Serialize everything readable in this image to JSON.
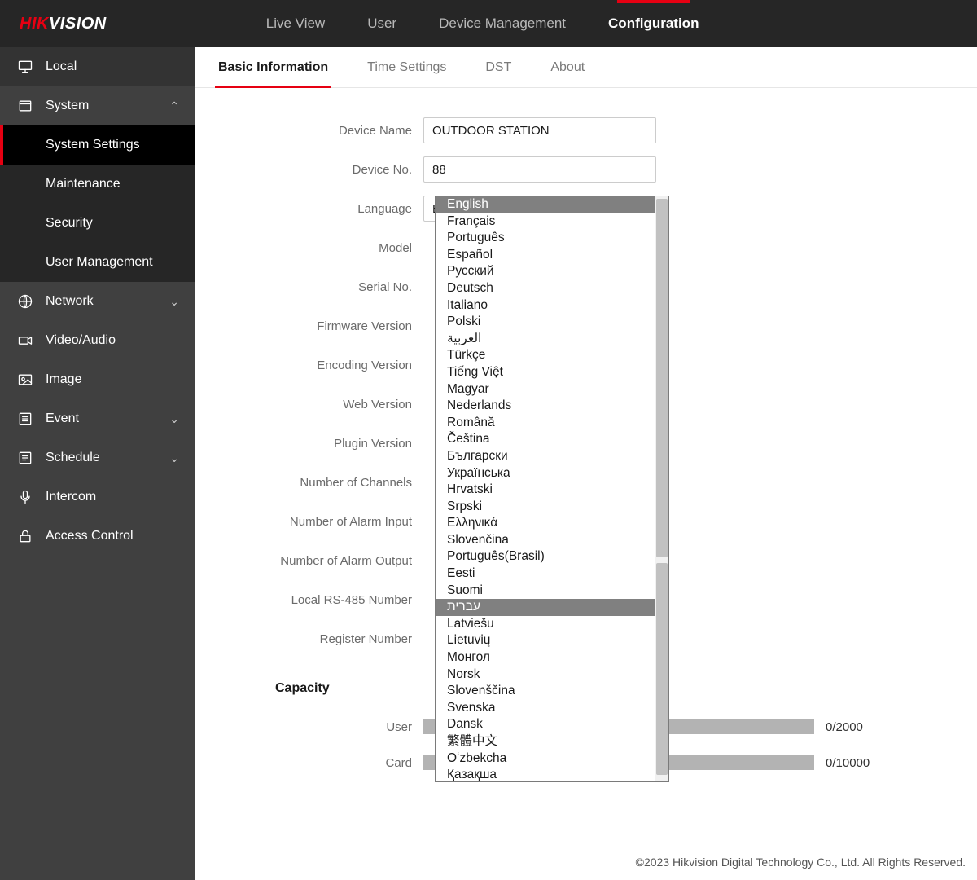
{
  "logo": {
    "part1": "HIK",
    "part2": "VISION"
  },
  "top_nav": [
    {
      "label": "Live View",
      "active": false
    },
    {
      "label": "User",
      "active": false
    },
    {
      "label": "Device Management",
      "active": false
    },
    {
      "label": "Configuration",
      "active": true
    }
  ],
  "sidebar": [
    {
      "kind": "item",
      "label": "Local",
      "icon": "monitor",
      "darker": true
    },
    {
      "kind": "item",
      "label": "System",
      "icon": "box",
      "chevron": "up",
      "expanded": true
    },
    {
      "kind": "sub",
      "label": "System Settings",
      "active": true
    },
    {
      "kind": "sub",
      "label": "Maintenance",
      "active": false
    },
    {
      "kind": "sub",
      "label": "Security",
      "active": false
    },
    {
      "kind": "sub",
      "label": "User Management",
      "active": false
    },
    {
      "kind": "item",
      "label": "Network",
      "icon": "globe",
      "chevron": "down"
    },
    {
      "kind": "item",
      "label": "Video/Audio",
      "icon": "camera",
      "chevron": ""
    },
    {
      "kind": "item",
      "label": "Image",
      "icon": "image",
      "chevron": ""
    },
    {
      "kind": "item",
      "label": "Event",
      "icon": "list",
      "chevron": "down"
    },
    {
      "kind": "item",
      "label": "Schedule",
      "icon": "calendar",
      "chevron": "down"
    },
    {
      "kind": "item",
      "label": "Intercom",
      "icon": "mic",
      "chevron": ""
    },
    {
      "kind": "item",
      "label": "Access Control",
      "icon": "lock",
      "chevron": ""
    }
  ],
  "tabs": [
    {
      "label": "Basic Information",
      "active": true
    },
    {
      "label": "Time Settings",
      "active": false
    },
    {
      "label": "DST",
      "active": false
    },
    {
      "label": "About",
      "active": false
    }
  ],
  "form": {
    "device_name": {
      "label": "Device Name",
      "value": "OUTDOOR STATION"
    },
    "device_no": {
      "label": "Device No.",
      "value": "88"
    },
    "language": {
      "label": "Language",
      "value": "English"
    },
    "rows": [
      {
        "label": "Model"
      },
      {
        "label": "Serial No."
      },
      {
        "label": "Firmware Version"
      },
      {
        "label": "Encoding Version"
      },
      {
        "label": "Web Version"
      },
      {
        "label": "Plugin Version"
      },
      {
        "label": "Number of Channels"
      },
      {
        "label": "Number of Alarm Input"
      },
      {
        "label": "Number of Alarm Output"
      },
      {
        "label": "Local RS-485 Number"
      },
      {
        "label": "Register Number"
      }
    ]
  },
  "capacity": {
    "title": "Capacity",
    "rows": [
      {
        "label": "User",
        "value": "0/2000"
      },
      {
        "label": "Card",
        "value": "0/10000"
      }
    ]
  },
  "language_options": [
    "English",
    "Français",
    "Português",
    "Español",
    "Русский",
    "Deutsch",
    "Italiano",
    "Polski",
    "العربية",
    "Türkçe",
    "Tiếng Việt",
    "Magyar",
    "Nederlands",
    "Română",
    "Čeština",
    "Български",
    "Українська",
    "Hrvatski",
    "Srpski",
    "Ελληνικά",
    "Slovenčina",
    "Português(Brasil)",
    "Eesti",
    "Suomi",
    "עברית",
    "Latviešu",
    "Lietuvių",
    "Монгол",
    "Norsk",
    "Slovenščina",
    "Svenska",
    "Dansk",
    "繁體中文",
    "Oʻzbekcha",
    "Қазақша"
  ],
  "language_selected_index": 0,
  "language_hover_index": 24,
  "footer": "©2023 Hikvision Digital Technology Co., Ltd. All Rights Reserved."
}
